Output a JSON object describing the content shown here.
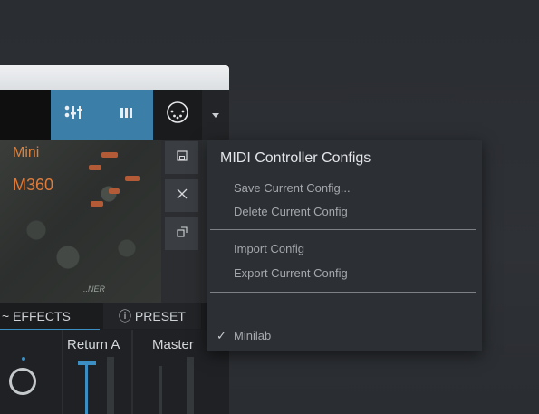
{
  "instrument": {
    "name_line1": "Mini",
    "name_line2": "M360",
    "art_caption": "..NER"
  },
  "toolbar": {
    "mixer_icon": "mixer-sliders-icon",
    "keys_icon": "keyboard-icon",
    "midi_icon": "midi-din-icon",
    "dropdown_icon": "caret-down-icon",
    "accent_color": "#3b7ea8"
  },
  "side_buttons": {
    "save_icon": "save-config-icon",
    "close_icon": "close-icon",
    "expand_icon": "expand-icon"
  },
  "tabs": {
    "effects": "~ EFFECTS",
    "preset": "ⓘ PRESET"
  },
  "mixer": {
    "return_a": "Return A",
    "master": "Master"
  },
  "midi_menu": {
    "title": "MIDI Controller Configs",
    "save": "Save Current Config...",
    "delete": "Delete Current Config",
    "import": "Import Config",
    "export": "Export Current Config",
    "selected_config": "Minilab",
    "check_mark": "✓"
  }
}
